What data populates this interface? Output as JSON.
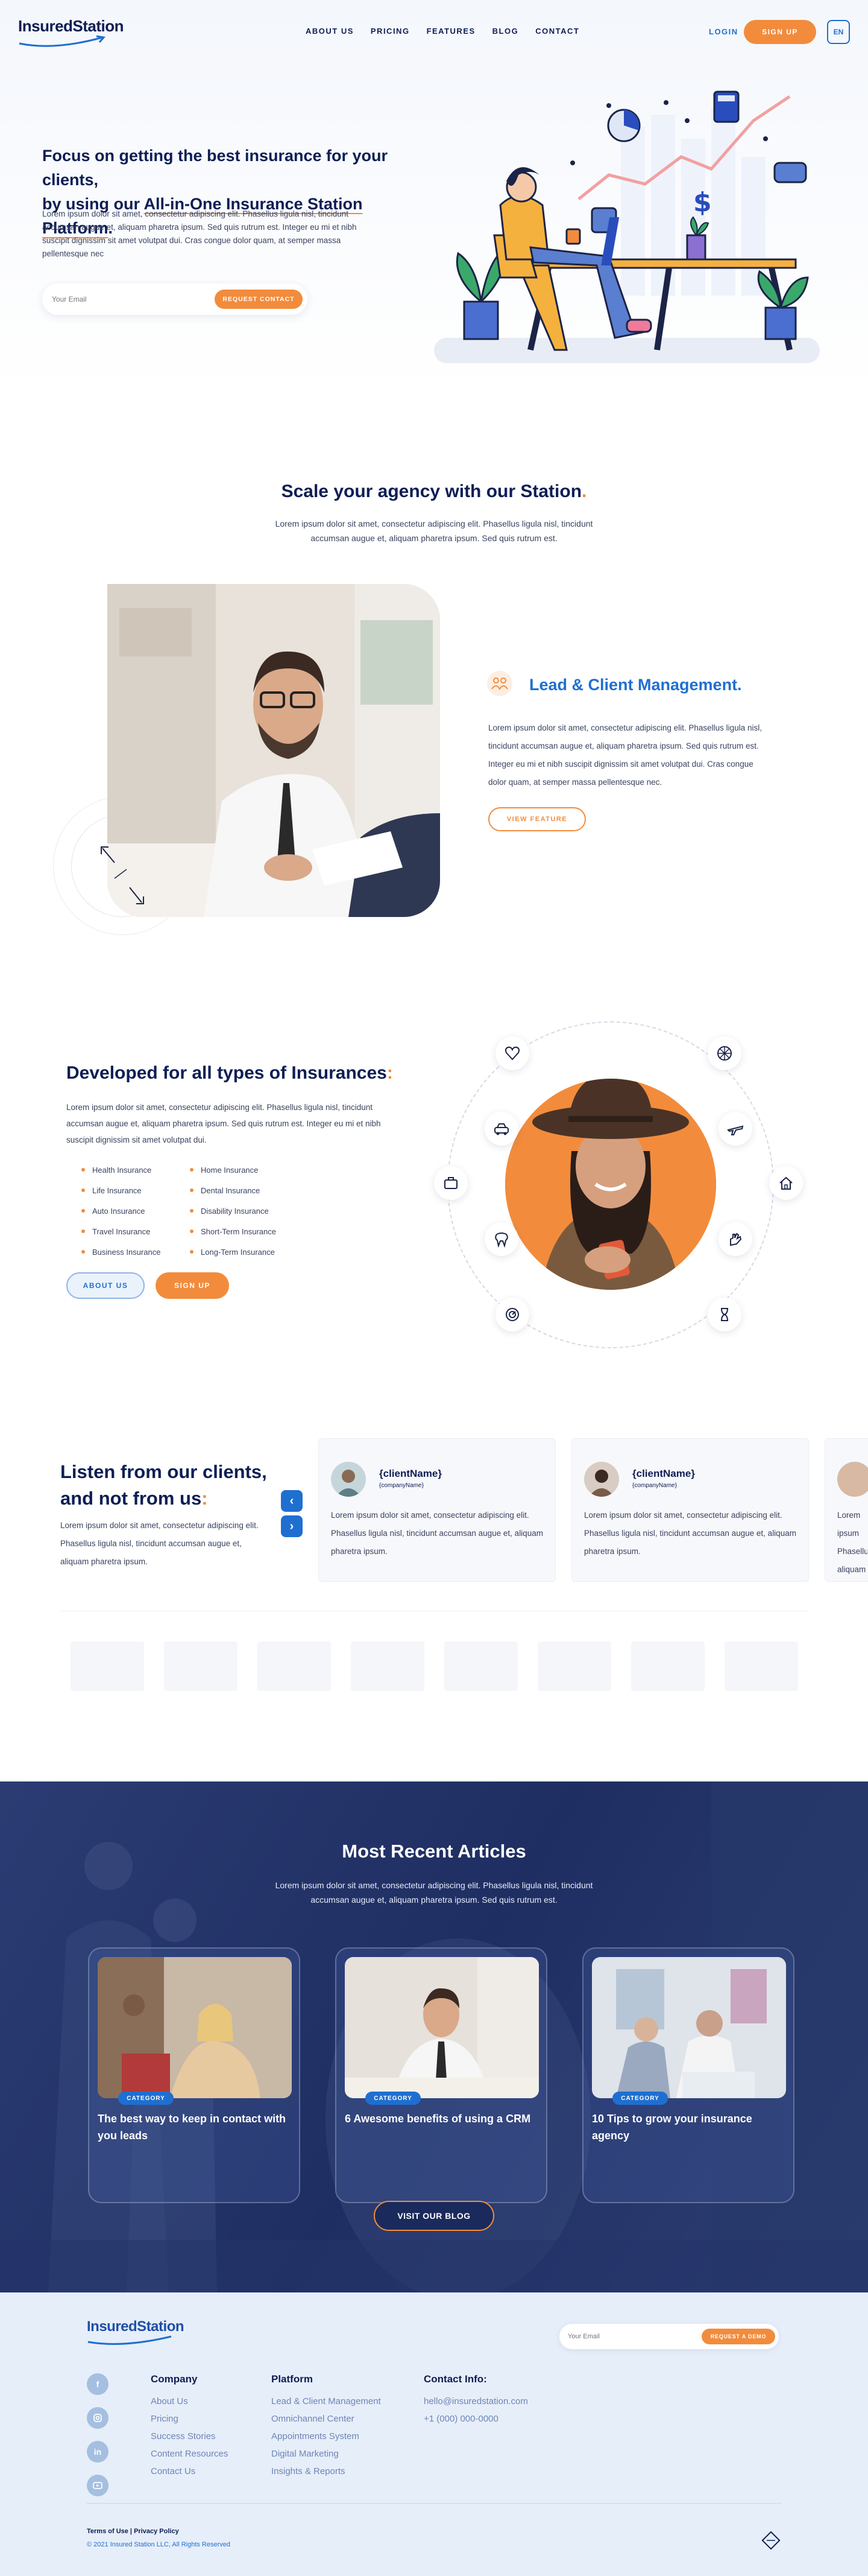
{
  "header": {
    "logo": "InsuredStation",
    "nav": [
      "ABOUT US",
      "PRICING",
      "FEATURES",
      "BLOG",
      "CONTACT"
    ],
    "login": "LOGIN",
    "signup": "SIGN UP",
    "lang": "EN"
  },
  "hero": {
    "title_line1": "Focus on getting the best insurance for your clients,",
    "title_line2a": "by using our ",
    "title_line2b": "All-in-One Insurance Station Platform",
    "title_line2c": ".",
    "body": "Lorem ipsum dolor sit amet, consectetur adipiscing elit. Phasellus ligula nisl, tincidunt accumsan augue et, aliquam pharetra ipsum. Sed quis rutrum est. Integer eu mi et nibh suscipit dignissim sit amet volutpat dui. Cras congue dolor quam, at semper massa pellentesque nec",
    "email_placeholder": "Your Email",
    "cta": "REQUEST CONTACT"
  },
  "scale": {
    "title": "Scale your agency with our Station",
    "dot": ".",
    "body": "Lorem ipsum dolor sit amet, consectetur adipiscing elit. Phasellus ligula nisl, tincidunt accumsan augue et, aliquam pharetra ipsum. Sed quis rutrum est.",
    "feature_title": "Lead & Client Management.",
    "feature_body": "Lorem ipsum dolor sit amet, consectetur adipiscing elit. Phasellus ligula nisl, tincidunt accumsan augue et, aliquam pharetra ipsum. Sed quis rutrum est. Integer eu mi et nibh suscipit dignissim sit amet volutpat dui. Cras congue dolor quam, at semper massa pellentesque nec.",
    "feature_btn": "VIEW FEATURE"
  },
  "types": {
    "title": "Developed for all types of Insurances",
    "colon": ":",
    "body": "Lorem ipsum dolor sit amet, consectetur adipiscing elit. Phasellus ligula nisl, tincidunt accumsan augue et, aliquam pharetra ipsum. Sed quis rutrum est. Integer eu mi et nibh suscipit dignissim sit amet volutpat dui.",
    "col1": [
      "Health Insurance",
      "Life Insurance",
      "Auto Insurance",
      "Travel Insurance",
      "Business Insurance"
    ],
    "col2": [
      "Home Insurance",
      "Dental Insurance",
      "Disability Insurance",
      "Short-Term Insurance",
      "Long-Term Insurance"
    ],
    "about_btn": "ABOUT US",
    "signup_btn": "SIGN UP"
  },
  "testimonials": {
    "title_line1": "Listen from our clients,",
    "title_line2": "and not from us",
    "colon": ":",
    "body": "Lorem ipsum dolor sit amet, consectetur adipiscing elit. Phasellus ligula nisl, tincidunt accumsan augue et, aliquam pharetra ipsum.",
    "cards": [
      {
        "name": "{clientName}",
        "company": "{companyName}",
        "text": "Lorem ipsum dolor sit amet, consectetur adipiscing elit. Phasellus ligula nisl, tincidunt accumsan augue et, aliquam pharetra ipsum."
      },
      {
        "name": "{clientName}",
        "company": "{companyName}",
        "text": "Lorem ipsum dolor sit amet, consectetur adipiscing elit. Phasellus ligula nisl, tincidunt accumsan augue et, aliquam pharetra ipsum."
      },
      {
        "name": "",
        "company": "",
        "text": "Lorem ipsum Phasellus aliquam"
      }
    ]
  },
  "articles": {
    "title": "Most Recent Articles",
    "body": "Lorem ipsum dolor sit amet, consectetur adipiscing elit. Phasellus ligula nisl, tincidunt accumsan augue et, aliquam pharetra ipsum. Sed quis rutrum est.",
    "items": [
      {
        "category": "CATEGORY",
        "title": "The best way to keep in contact with you leads"
      },
      {
        "category": "CATEGORY",
        "title": "6 Awesome benefits of using a CRM"
      },
      {
        "category": "CATEGORY",
        "title": "10 Tips to grow your insurance agency"
      }
    ],
    "cta": "VISIT OUR BLOG"
  },
  "footer": {
    "logo": "InsuredStation",
    "email_placeholder": "Your Email",
    "cta": "REQUEST A DEMO",
    "company_head": "Company",
    "company_links": [
      "About Us",
      "Pricing",
      "Success Stories",
      "Content Resources",
      "Contact Us"
    ],
    "platform_head": "Platform",
    "platform_links": [
      "Lead & Client Management",
      "Omnichannel Center",
      "Appointments System",
      "Digital Marketing",
      "Insights & Reports"
    ],
    "contact_head": "Contact Info:",
    "contact_email": "hello@insuredstation.com",
    "contact_phone": "+1 (000) 000-0000",
    "legal_terms": "Terms of Use",
    "legal_sep": " | ",
    "legal_privacy": "Privacy Policy",
    "copyright": "© 2021 Insured Station LLC, All Rights Reserved"
  },
  "colors": {
    "navy": "#0e1e55",
    "orange": "#f28c3c",
    "blue": "#1f6fd1",
    "footer_bg": "#e6eef9",
    "articles_bg": "#26386b"
  },
  "icons": {
    "social": [
      "facebook-icon",
      "instagram-icon",
      "linkedin-icon",
      "youtube-icon"
    ],
    "insurance_circle": [
      "heart-icon",
      "car-icon",
      "briefcase-icon",
      "tooth-icon",
      "speedometer-icon",
      "aperture-icon",
      "plane-icon",
      "home-icon",
      "hand-icon",
      "hourglass-icon"
    ]
  }
}
